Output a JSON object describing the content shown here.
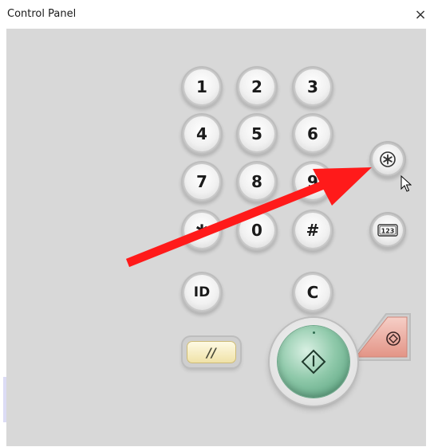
{
  "window": {
    "title": "Control Panel",
    "close_glyph": "×"
  },
  "keypad": {
    "keys": [
      "1",
      "2",
      "3",
      "4",
      "5",
      "6",
      "7",
      "8",
      "9",
      "✱",
      "0",
      "#"
    ],
    "id_label": "ID",
    "clear_label": "C"
  },
  "function_keys": {
    "settings_icon": "asterisk-circle-icon",
    "counter_label": "123"
  },
  "controls": {
    "reset_label": "//",
    "start_icon": "start-diamond-icon",
    "stop_icon": "stop-octagon-icon"
  },
  "colors": {
    "panel_bg": "#d8d8d8",
    "start_green": "#5ba883",
    "stop_red": "#e8a79c",
    "reset_yellow": "#f3e6b0",
    "annotation_arrow": "#ff1a1a"
  }
}
